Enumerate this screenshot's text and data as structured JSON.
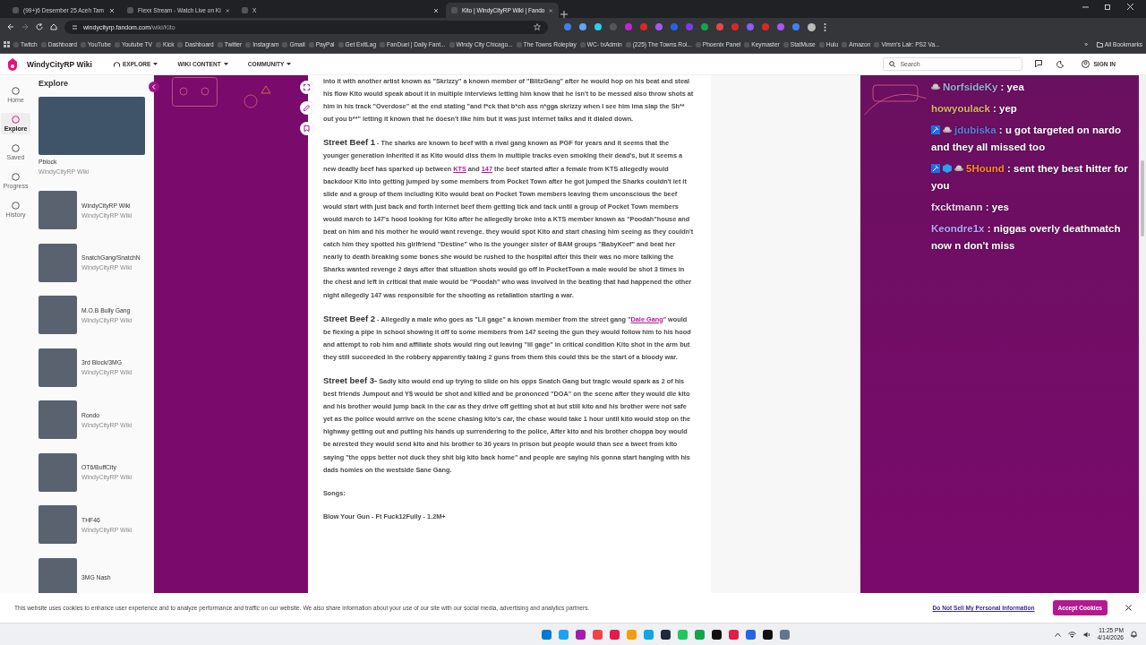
{
  "browser": {
    "tabs": [
      {
        "title": "(99+)6 Desember 25 Aceh Tam",
        "selected": false
      },
      {
        "title": "Flexx Stream - Watch Live on Ki",
        "selected": false
      },
      {
        "title": "X",
        "selected": false
      },
      {
        "title": "Kito | WindyCityRP Wiki | Fando",
        "selected": true
      }
    ],
    "url_host": "windycityrp.fandom.com",
    "url_path": "/wiki/Kito",
    "bookmarks": [
      "Twitch",
      "Dashboard",
      "YouTube",
      "Youtube TV",
      "Kick",
      "Dashboard",
      "Twitter",
      "Instagram",
      "Gmail",
      "PayPal",
      "Get ExitLag",
      "FanDuel | Daily Fant...",
      "Windy City Chicago...",
      "The Towns Roleplay",
      "WC- txAdmin",
      "(225) The Towns Rol...",
      "Phoenix Panel",
      "Keymaster",
      "StatMuse",
      "Hulu",
      "Amazon",
      "Vimm's Lair: PS2 Va..."
    ],
    "bookmarks_more": "»",
    "all_bookmarks": "All Bookmarks"
  },
  "site": {
    "name": "WindyCityRP Wiki",
    "nav": [
      "EXPLORE",
      "WIKI CONTENT",
      "COMMUNITY"
    ],
    "search": {
      "placeholder": "Search"
    },
    "sign_in": "SIGN IN"
  },
  "rail": [
    {
      "label": "Home",
      "selected": false
    },
    {
      "label": "Explore",
      "selected": true
    },
    {
      "label": "Saved",
      "selected": false
    },
    {
      "label": "Progress",
      "selected": false
    },
    {
      "label": "History",
      "selected": false
    }
  ],
  "explore": {
    "title": "Explore",
    "items": [
      {
        "kind": "featured",
        "title": "Pblock",
        "subtitle": "WindyCityRP Wiki"
      },
      {
        "kind": "row",
        "title": "WindyCityRP Wiki",
        "subtitle": "WindyCityRP Wiki"
      },
      {
        "kind": "row",
        "title": "SnatchGang/SnatchN",
        "subtitle": "WindyCityRP Wiki"
      },
      {
        "kind": "row",
        "title": "M.O.B Bully Gang",
        "subtitle": "WindyCityRP Wiki"
      },
      {
        "kind": "row",
        "title": "3rd Block/3MG",
        "subtitle": "WindyCityRP Wiki"
      },
      {
        "kind": "row",
        "title": "Rondo",
        "subtitle": "WindyCityRP Wiki"
      },
      {
        "kind": "row",
        "title": "OT6/BuffCity",
        "subtitle": "WindyCityRP Wiki"
      },
      {
        "kind": "row",
        "title": "THF46",
        "subtitle": "WindyCityRP Wiki"
      },
      {
        "kind": "row",
        "title": "3MG Nash"
      }
    ]
  },
  "article": {
    "paragraphs": [
      {
        "segments": [
          {
            "kind": "text",
            "text": "into it with another artist known as \"Skrizzy\" a known member of \"BlitzGang\" after he would hop on his beat and steal his flow Kito would speak about it in multiple interviews letting him know that he isn't to be messed also throw shots at him in his track \"Overdose\" at the end stating \"and f*ck that b*ch ass n*gga skrizzy when I see him ima slap the Sh** out you b**\" letting it known that he doesn't like him but it was just internet talks and it dialed down."
          }
        ]
      },
      {
        "heading": "Street Beef 1",
        "segments": [
          {
            "kind": "text",
            "text": " - The sharks are known to beef with a rival gang known as PGF for years and it seems that the younger generation inherited it as Kito would diss them in multiple tracks even smoking their dead's, but it seems a new deadly beef has sparked up between "
          },
          {
            "kind": "link",
            "text": "KTS"
          },
          {
            "kind": "text",
            "text": " and "
          },
          {
            "kind": "link",
            "text": "147"
          },
          {
            "kind": "text",
            "text": " the beef started after a female from KTS allegedly would backdoor Kito into getting jumped by some members from Pocket Town after he got jumped the Sharks couldn't let it slide and a group of them including Kito would beat on Pocket Town members leaving them unconscious the beef would start with just back and forth internet beef them getting tick and tack until a group of Pocket Town members would march to 147's hood looking for Kito after he allegedly broke into a KTS member known as \"Poodah\"house and beat on him and his mother he would want revenge. they would spot Kito and start chasing him seeing as they couldn't catch him they spotted his girlfriend \"Destine\" who is the younger sister of BAM groups \"BabyKeef\" and beat her nearly to death breaking some bones she would be rushed to the hospital after this their was no more talking the Sharks wanted revenge 2 days after that situation shots would go off in PocketTown a male would be shot 3 times in the chest and left in critical that male would be \"Poodah\" who was involved in the beating that had happened the other night allegedly 147 was responsible for the shooting as retaliation starting a war."
          }
        ]
      },
      {
        "heading": "Street Beef 2",
        "segments": [
          {
            "kind": "text",
            "text": " - Allegedly a male who goes as \"Lil gage\" a known member from the street gang \""
          },
          {
            "kind": "link",
            "text": "Dale Gang"
          },
          {
            "kind": "text",
            "text": "\" would be flexing a pipe in school showing it off to some members from 147 seeing the gun they would follow him to his hood and attempt to rob him and affiliate shots would ring out leaving \"lil gage\" in critical condition Kito shot in the arm but they still succeeded in the robbery apparently taking 2 guns from them this could this be the start of a bloody war."
          }
        ]
      },
      {
        "heading": "Street beef 3-",
        "segments": [
          {
            "kind": "text",
            "text": " Sadly kito would end up trying to slide on his opps Snatch Gang but tragic would spark as 2 of his best friends Jumpout and Y$ would be shot and killed and be prononced \"DOA\" on the scene after they would die kito and his brother would jump back in the car as they drive off getting shot at but still kito and his brother were not safe yet as the police would arrive on the scene chasing kito's car, the chase would take 1 hour until kito would stop on the highway getting out and putting his hands up surrendering to the police, After kito and his brother choppa boy would be arrested they would send kito and his brother to 30 years in prison but people would than see a tweet from kito saying \"the opps better not duck they shit big kito back home\" and people are saying his gonna start hanging with his dads homies on the westside Sane Gang."
          }
        ]
      },
      {
        "segments": [
          {
            "kind": "text",
            "text": "Songs:"
          }
        ]
      },
      {
        "segments": [
          {
            "kind": "text",
            "text": "Blow Your Gun - Ft Fuck12Fully - 1.2M+"
          }
        ]
      }
    ]
  },
  "chat": [
    {
      "kind": "hat",
      "user": "NorfsideKy",
      "color": "#9aaed8",
      "text": ": yea"
    },
    {
      "kind": "plain",
      "user": "howyoulack",
      "color": "#d9b36a",
      "text": ": yep"
    },
    {
      "kind": "mod",
      "user": "jdubiska",
      "color": "#5b7ee0",
      "text": ": u got targeted on nardo and they all missed too"
    },
    {
      "kind": "modsub",
      "user": "5Hound",
      "color": "#ff8a1e",
      "text": ": sent they best hitter for you"
    },
    {
      "kind": "plain",
      "user": "fxcktmann",
      "color": "#f0d2f0",
      "text": ": yes"
    },
    {
      "kind": "plain",
      "user": "Keondre1x",
      "color": "#b9a6ff",
      "text": ": niggas overly deathmatch now n don't miss"
    }
  ],
  "cookie_banner": {
    "text": "This website uses cookies to enhance user experience and to analyze performance and traffic on our website. We also share information about your use of our site with our social media, advertising and analytics partners.",
    "link": "Do Not Sell My Personal Information",
    "accept": "Accept Cookies"
  },
  "taskbar": {
    "time": "11:25 PM",
    "date": "4/14/2026"
  }
}
